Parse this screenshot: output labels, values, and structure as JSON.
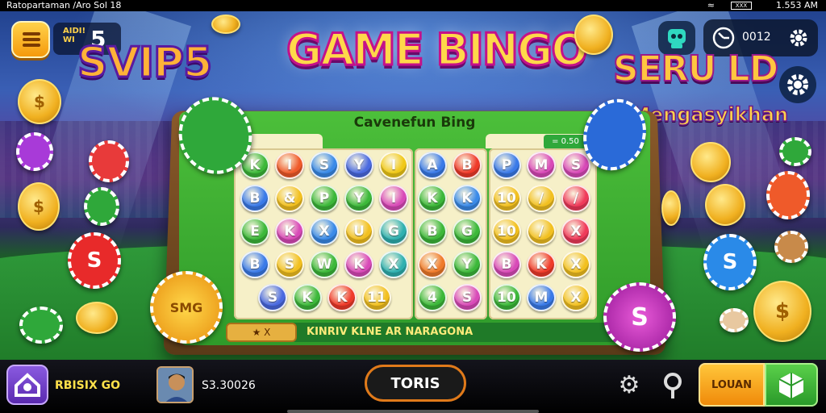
{
  "status_bar": {
    "left_text": "Ratopartaman /Aro Sol 18",
    "battery": "XXX",
    "time": "1.553 AM"
  },
  "header": {
    "menu_icon": "hamburger-icon",
    "level_label": "AIDI! WI",
    "level_value": "5",
    "vip_text": "SVIP5",
    "title": "GAME BINGO"
  },
  "top_right": {
    "mascot_icon": "robot-icon",
    "timer_icon": "clock-icon",
    "timer_text": "0012",
    "settings_icon": "gear-icon",
    "secondary_settings_icon": "gear-icon",
    "promo_line1": "SERU LD",
    "promo_line2": "Mengasyikhan"
  },
  "board": {
    "title": "Cavenefun Bing",
    "score_tab": "= 0.50",
    "footer_left": "★ X",
    "footer_text": "KINRIV KLNE AR NARAGONA",
    "left_panel_balls": [
      [
        {
          "t": "K",
          "c": "#3cb83a"
        },
        {
          "t": "I",
          "c": "#ef5a2a"
        },
        {
          "t": "S",
          "c": "#3a8ae8"
        },
        {
          "t": "Y",
          "c": "#4a6ae0"
        },
        {
          "t": "I",
          "c": "#f0c818"
        }
      ],
      [
        {
          "t": "B",
          "c": "#3a7ae8"
        },
        {
          "t": "&",
          "c": "#f2c020"
        },
        {
          "t": "P",
          "c": "#3cb83a"
        },
        {
          "t": "Y",
          "c": "#3cb83a"
        },
        {
          "t": "I",
          "c": "#d84ab8"
        }
      ],
      [
        {
          "t": "E",
          "c": "#3cb83a"
        },
        {
          "t": "K",
          "c": "#d84ab8"
        },
        {
          "t": "X",
          "c": "#3a8ae8"
        },
        {
          "t": "U",
          "c": "#f2c020"
        },
        {
          "t": "G",
          "c": "#2fb0b0"
        }
      ],
      [
        {
          "t": "B",
          "c": "#3a7ae8"
        },
        {
          "t": "S",
          "c": "#f2c020"
        },
        {
          "t": "W",
          "c": "#3cb83a"
        },
        {
          "t": "K",
          "c": "#d84ab8"
        },
        {
          "t": "X",
          "c": "#2fb0b0"
        }
      ],
      [
        {
          "t": "S",
          "c": "#4a6ae0"
        },
        {
          "t": "K",
          "c": "#3cb83a"
        },
        {
          "t": "K",
          "c": "#ef3a2a"
        },
        {
          "t": "11",
          "c": "#f2c020"
        }
      ]
    ],
    "middle_panel_balls": [
      [
        {
          "t": "A",
          "c": "#3a7ae8"
        },
        {
          "t": "B",
          "c": "#ef3a2a"
        }
      ],
      [
        {
          "t": "K",
          "c": "#3cb83a"
        },
        {
          "t": "K",
          "c": "#3a8ae8"
        }
      ],
      [
        {
          "t": "B",
          "c": "#3cb83a"
        },
        {
          "t": "G",
          "c": "#3cb83a"
        }
      ],
      [
        {
          "t": "X",
          "c": "#ef7a2a"
        },
        {
          "t": "Y",
          "c": "#3cb83a"
        }
      ],
      [
        {
          "t": "4",
          "c": "#3cb83a"
        },
        {
          "t": "S",
          "c": "#d84ab8"
        }
      ]
    ],
    "right_panel_balls": [
      [
        {
          "t": "P",
          "c": "#3a7ae8"
        },
        {
          "t": "M",
          "c": "#d84ab8"
        },
        {
          "t": "S",
          "c": "#d84ab8"
        }
      ],
      [
        {
          "t": "10",
          "c": "#f2c020"
        },
        {
          "t": "/",
          "c": "#f2c020"
        },
        {
          "t": "/",
          "c": "#ef3a5a"
        }
      ],
      [
        {
          "t": "10",
          "c": "#f2c020"
        },
        {
          "t": "/",
          "c": "#f2c020"
        },
        {
          "t": "X",
          "c": "#ef3a5a"
        }
      ],
      [
        {
          "t": "B",
          "c": "#d84ab8"
        },
        {
          "t": "K",
          "c": "#ef3a2a"
        },
        {
          "t": "X",
          "c": "#f2c020"
        }
      ],
      [
        {
          "t": "10",
          "c": "#3cb83a"
        },
        {
          "t": "M",
          "c": "#3a7ae8"
        },
        {
          "t": "X",
          "c": "#f2c020"
        }
      ]
    ]
  },
  "chips": {
    "big_chip_left": "SMG",
    "big_chip_right": "S",
    "chip_left_red": "S",
    "chip_right_blue": "S"
  },
  "bottom_bar": {
    "home_icon": "home-icon",
    "user_name": "RBISIX GO",
    "avatar_icon": "player-avatar",
    "balance": "S3.30026",
    "play_label": "TORIS",
    "settings_icon": "gear-icon",
    "pin_icon": "location-pin-icon",
    "login_label": "LOUAN",
    "store_icon": "gift-box-icon"
  }
}
